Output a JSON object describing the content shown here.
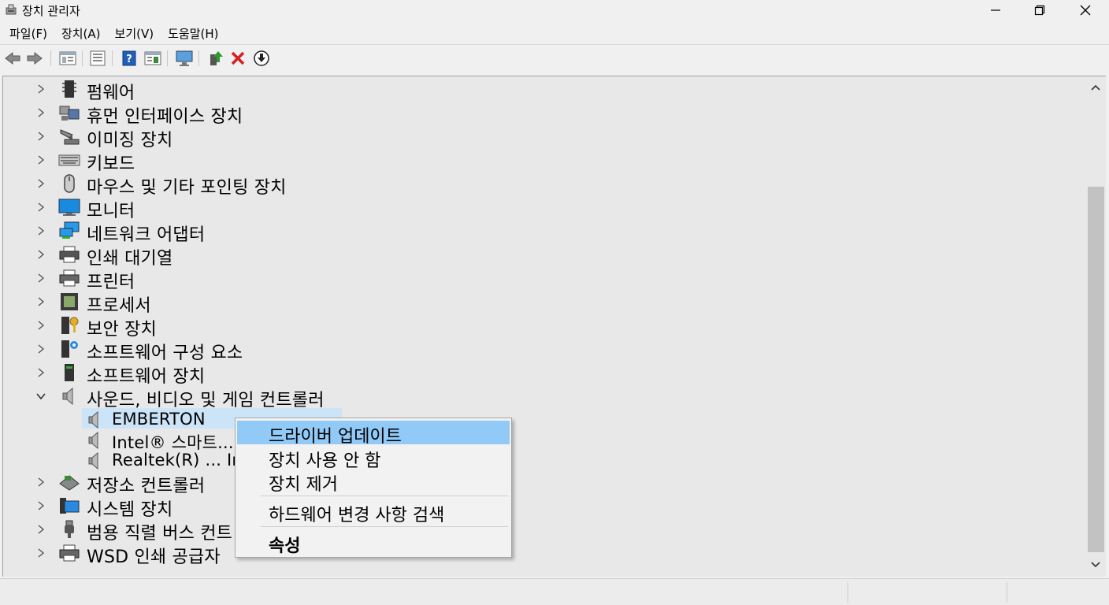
{
  "window": {
    "title": "장치 관리자",
    "icon": "device-manager-icon"
  },
  "menu": {
    "items": [
      "파일(F)",
      "장치(A)",
      "보기(V)",
      "도움말(H)"
    ]
  },
  "toolbar": {
    "buttons": [
      "back-arrow-icon",
      "forward-arrow-icon",
      "properties-sheet-icon",
      "device-list-icon",
      "help-icon",
      "view-details-icon",
      "monitor-scan-icon",
      "update-driver-icon",
      "uninstall-x-icon",
      "download-icon"
    ]
  },
  "tree": {
    "categories": [
      {
        "label": "펌웨어",
        "icon": "firmware-chip-icon",
        "expanded": false
      },
      {
        "label": "휴먼 인터페이스 장치",
        "icon": "hid-icon",
        "expanded": false
      },
      {
        "label": "이미징 장치",
        "icon": "camera-icon",
        "expanded": false
      },
      {
        "label": "키보드",
        "icon": "keyboard-icon",
        "expanded": false
      },
      {
        "label": "마우스 및 기타 포인팅 장치",
        "icon": "mouse-icon",
        "expanded": false
      },
      {
        "label": "모니터",
        "icon": "monitor-icon",
        "expanded": false
      },
      {
        "label": "네트워크 어댑터",
        "icon": "network-adapter-icon",
        "expanded": false
      },
      {
        "label": "인쇄 대기열",
        "icon": "printer-queue-icon",
        "expanded": false
      },
      {
        "label": "프린터",
        "icon": "printer-icon",
        "expanded": false
      },
      {
        "label": "프로세서",
        "icon": "processor-icon",
        "expanded": false
      },
      {
        "label": "보안 장치",
        "icon": "security-key-icon",
        "expanded": false
      },
      {
        "label": "소프트웨어 구성 요소",
        "icon": "software-component-icon",
        "expanded": false
      },
      {
        "label": "소프트웨어 장치",
        "icon": "software-device-icon",
        "expanded": false
      },
      {
        "label": "사운드, 비디오 및 게임 컨트롤러",
        "icon": "speaker-icon",
        "expanded": true
      }
    ],
    "sound_children": [
      {
        "label": "EMBERTON",
        "selected": true
      },
      {
        "label": "Intel® 스마트..."
      },
      {
        "label": "Realtek(R) ... Int"
      }
    ],
    "categories_after": [
      {
        "label": "저장소 컨트롤러",
        "icon": "storage-controller-icon"
      },
      {
        "label": "시스템 장치",
        "icon": "system-folder-icon"
      },
      {
        "label": "범용 직렬 버스 컨트",
        "icon": "usb-icon"
      },
      {
        "label": "WSD 인쇄 공급자",
        "icon": "wsd-printer-icon"
      }
    ]
  },
  "context_menu": {
    "items": [
      {
        "label": "드라이버 업데이트",
        "highlighted": true
      },
      {
        "label": "장치 사용 안 함"
      },
      {
        "label": "장치 제거"
      },
      {
        "label": "하드웨어 변경 사항 검색"
      },
      {
        "label": "속성",
        "bold": true
      }
    ]
  },
  "colors": {
    "selection": "#cce4f7",
    "menu_highlight": "#91c9f7",
    "uninstall_red": "#d42020",
    "update_green": "#2e9a2e",
    "help_blue": "#1f5fb8"
  }
}
